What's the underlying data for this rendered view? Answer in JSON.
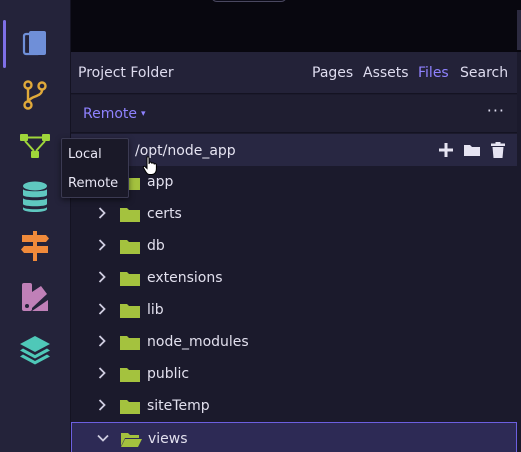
{
  "activity_bar": {
    "items": [
      {
        "name": "explorer-icon",
        "color": "#6f8fd8"
      },
      {
        "name": "git-branch-icon",
        "color": "#e0a93a"
      },
      {
        "name": "git-graph-icon",
        "color": "#9fd63a"
      },
      {
        "name": "database-icon",
        "color": "#5fc8c0"
      },
      {
        "name": "signpost-icon",
        "color": "#f08a3a"
      },
      {
        "name": "palette-icon",
        "color": "#c080b8"
      },
      {
        "name": "layers-icon",
        "color": "#4fc8b8"
      }
    ],
    "accent": "#7e6fe6"
  },
  "panel": {
    "title": "Project Folder",
    "tabs": [
      {
        "label": "Pages",
        "active": false
      },
      {
        "label": "Assets",
        "active": false
      },
      {
        "label": "Files",
        "active": true
      },
      {
        "label": "Search",
        "active": false
      }
    ]
  },
  "toolbar": {
    "dropdown_label": "Remote",
    "dropdown_caret": "▾",
    "more_label": "···"
  },
  "popup_menu": {
    "items": [
      "Local",
      "Remote"
    ]
  },
  "tree": {
    "path": "/opt/node_app",
    "actions": [
      "add-icon",
      "new-folder-icon",
      "trash-icon"
    ],
    "folders": [
      {
        "name": "app",
        "expanded": false,
        "selected": false
      },
      {
        "name": "certs",
        "expanded": false,
        "selected": false
      },
      {
        "name": "db",
        "expanded": false,
        "selected": false
      },
      {
        "name": "extensions",
        "expanded": false,
        "selected": false
      },
      {
        "name": "lib",
        "expanded": false,
        "selected": false
      },
      {
        "name": "node_modules",
        "expanded": false,
        "selected": false
      },
      {
        "name": "public",
        "expanded": false,
        "selected": false
      },
      {
        "name": "siteTemp",
        "expanded": false,
        "selected": false
      },
      {
        "name": "views",
        "expanded": true,
        "selected": true
      }
    ],
    "folder_color": "#a4c23e"
  }
}
